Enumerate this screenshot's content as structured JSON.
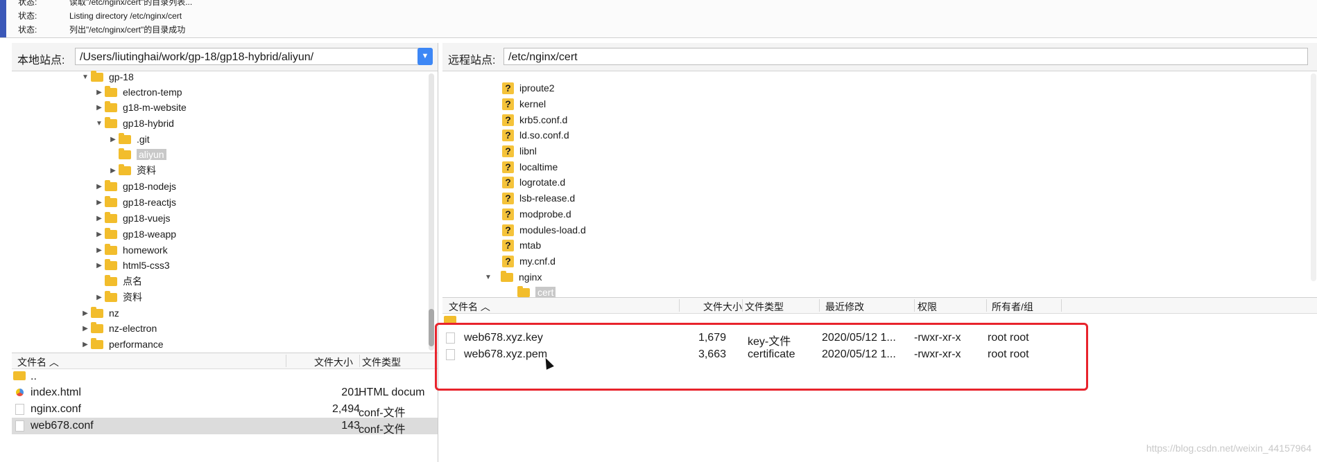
{
  "status_log": [
    {
      "label": "状态:",
      "message": "读取\"/etc/nginx/cert\"的目录列表..."
    },
    {
      "label": "状态:",
      "message": "Listing directory /etc/nginx/cert"
    },
    {
      "label": "状态:",
      "message": "列出\"/etc/nginx/cert\"的目录成功"
    }
  ],
  "local": {
    "site_label": "本地站点:",
    "path": "/Users/liutinghai/work/gp-18/gp18-hybrid/aliyun/",
    "tree": [
      {
        "name": "gp-18",
        "expanded": true
      },
      {
        "name": "electron-temp",
        "expanded": false
      },
      {
        "name": "g18-m-website",
        "expanded": false
      },
      {
        "name": "gp18-hybrid",
        "expanded": true
      },
      {
        "name": ".git",
        "expanded": false
      },
      {
        "name": "aliyun",
        "selected": true
      },
      {
        "name": "资料",
        "expanded": false
      },
      {
        "name": "gp18-nodejs",
        "expanded": false
      },
      {
        "name": "gp18-reactjs",
        "expanded": false
      },
      {
        "name": "gp18-vuejs",
        "expanded": false
      },
      {
        "name": "gp18-weapp",
        "expanded": false
      },
      {
        "name": "homework",
        "expanded": false
      },
      {
        "name": "html5-css3",
        "expanded": false
      },
      {
        "name": "点名"
      },
      {
        "name": "资料",
        "expanded": false
      },
      {
        "name": "nz",
        "expanded": false
      },
      {
        "name": "nz-electron",
        "expanded": false
      },
      {
        "name": "performance",
        "expanded": false
      }
    ],
    "columns": {
      "name": "文件名",
      "size": "文件大小",
      "type": "文件类型"
    },
    "files": [
      {
        "name": "..",
        "size": "",
        "type": ""
      },
      {
        "name": "index.html",
        "size": "201",
        "type": "HTML docum"
      },
      {
        "name": "nginx.conf",
        "size": "2,494",
        "type": "conf-文件"
      },
      {
        "name": "web678.conf",
        "size": "143",
        "type": "conf-文件",
        "selected": true
      }
    ]
  },
  "remote": {
    "site_label": "远程站点:",
    "path": "/etc/nginx/cert",
    "tree": [
      {
        "name": "iproute2",
        "icon": "unknown"
      },
      {
        "name": "kernel",
        "icon": "unknown"
      },
      {
        "name": "krb5.conf.d",
        "icon": "unknown"
      },
      {
        "name": "ld.so.conf.d",
        "icon": "unknown"
      },
      {
        "name": "libnl",
        "icon": "unknown"
      },
      {
        "name": "localtime",
        "icon": "unknown"
      },
      {
        "name": "logrotate.d",
        "icon": "unknown"
      },
      {
        "name": "lsb-release.d",
        "icon": "unknown"
      },
      {
        "name": "modprobe.d",
        "icon": "unknown"
      },
      {
        "name": "modules-load.d",
        "icon": "unknown"
      },
      {
        "name": "mtab",
        "icon": "unknown"
      },
      {
        "name": "my.cnf.d",
        "icon": "unknown"
      },
      {
        "name": "nginx",
        "icon": "folder",
        "expanded": true
      },
      {
        "name": "cert",
        "icon": "folder",
        "selected": true
      }
    ],
    "columns": {
      "name": "文件名",
      "size": "文件大小",
      "type": "文件类型",
      "modified": "最近修改",
      "perms": "权限",
      "owner": "所有者/组"
    },
    "files": [
      {
        "name": "..",
        "size": "",
        "type": "",
        "modified": "",
        "perms": "",
        "owner": ""
      },
      {
        "name": "web678.xyz.key",
        "size": "1,679",
        "type": "key-文件",
        "modified": "2020/05/12 1...",
        "perms": "-rwxr-xr-x",
        "owner": "root root"
      },
      {
        "name": "web678.xyz.pem",
        "size": "3,663",
        "type": "certificate",
        "modified": "2020/05/12 1...",
        "perms": "-rwxr-xr-x",
        "owner": "root root"
      }
    ]
  },
  "watermark": "https://blog.csdn.net/weixin_44157964",
  "colors": {
    "accent": "#3d87f5",
    "highlight": "#e8232c",
    "folder": "#f2bd2c"
  }
}
